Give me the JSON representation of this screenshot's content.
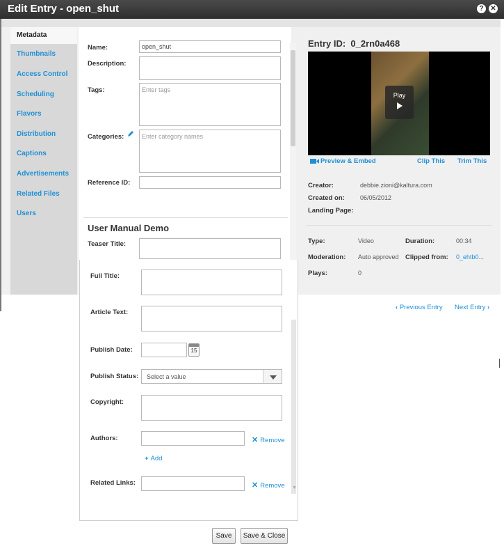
{
  "window": {
    "title": "Edit Entry - open_shut",
    "help_icon": "question-icon",
    "close_icon": "close-icon"
  },
  "sidebar": {
    "active": "Metadata",
    "items": [
      "Thumbnails",
      "Access Control",
      "Scheduling",
      "Flavors",
      "Distribution",
      "Captions",
      "Advertisements",
      "Related Files",
      "Users"
    ]
  },
  "form": {
    "name_label": "Name:",
    "name_value": "open_shut",
    "description_label": "Description:",
    "tags_label": "Tags:",
    "tags_placeholder": "Enter tags",
    "categories_label": "Categories:",
    "categories_placeholder": "Enter category names",
    "reference_label": "Reference ID:",
    "section_title": "User Manual Demo",
    "teaser_label": "Teaser Title:",
    "full_title_label": "Full Title:",
    "article_label": "Article Text:",
    "publish_date_label": "Publish Date:",
    "calendar_day": "15",
    "publish_status_label": "Publish Status:",
    "publish_status_value": "Select a value",
    "copyright_label": "Copyright:",
    "authors_label": "Authors:",
    "remove_label": "Remove",
    "add_label": "Add",
    "related_links_label": "Related Links:"
  },
  "entry": {
    "id_label": "Entry ID:",
    "id_value": "0_2rn0a468",
    "play_label": "Play",
    "preview_embed": "Preview & Embed",
    "clip_this": "Clip This",
    "trim_this": "Trim This",
    "creator_label": "Creator:",
    "creator_value": "debbie.zioni@kaltura.com",
    "created_on_label": "Created on:",
    "created_on_value": "06/05/2012",
    "landing_label": "Landing Page:",
    "type_label": "Type:",
    "type_value": "Video",
    "duration_label": "Duration:",
    "duration_value": "00:34",
    "moderation_label": "Moderation:",
    "moderation_value": "Auto approved",
    "clipped_label": "Clipped from:",
    "clipped_value": "0_ehtb0...",
    "plays_label": "Plays:",
    "plays_value": "0",
    "prev_entry": "Previous Entry",
    "next_entry": "Next Entry"
  },
  "buttons": {
    "save": "Save",
    "save_close": "Save & Close"
  }
}
